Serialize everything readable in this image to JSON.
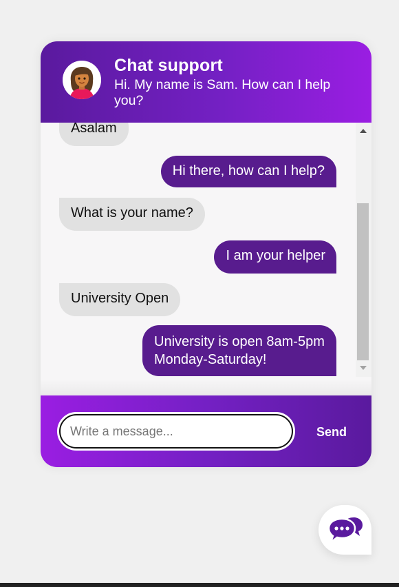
{
  "header": {
    "title": "Chat support",
    "subtitle": "Hi. My name is Sam. How can I help you?",
    "avatar_icon": "woman-avatar-icon"
  },
  "messages": [
    {
      "from": "user",
      "text": "Asalam"
    },
    {
      "from": "bot",
      "text": "Hi there, how can I help?"
    },
    {
      "from": "user",
      "text": "What is your name?"
    },
    {
      "from": "bot",
      "text": "I am your helper"
    },
    {
      "from": "user",
      "text": "University Open"
    },
    {
      "from": "bot",
      "text": "University is open 8am-5pm Monday-Saturday!"
    }
  ],
  "composer": {
    "placeholder": "Write a message...",
    "value": "",
    "send_label": "Send"
  },
  "launcher": {
    "icon": "chat-bubbles-icon"
  },
  "colors": {
    "header_gradient_start": "#5a1a9e",
    "header_gradient_end": "#9a1ee2",
    "sent_bubble": "#581c8e",
    "received_bubble": "#e1e1e1",
    "page_background": "#f0f0f0"
  }
}
